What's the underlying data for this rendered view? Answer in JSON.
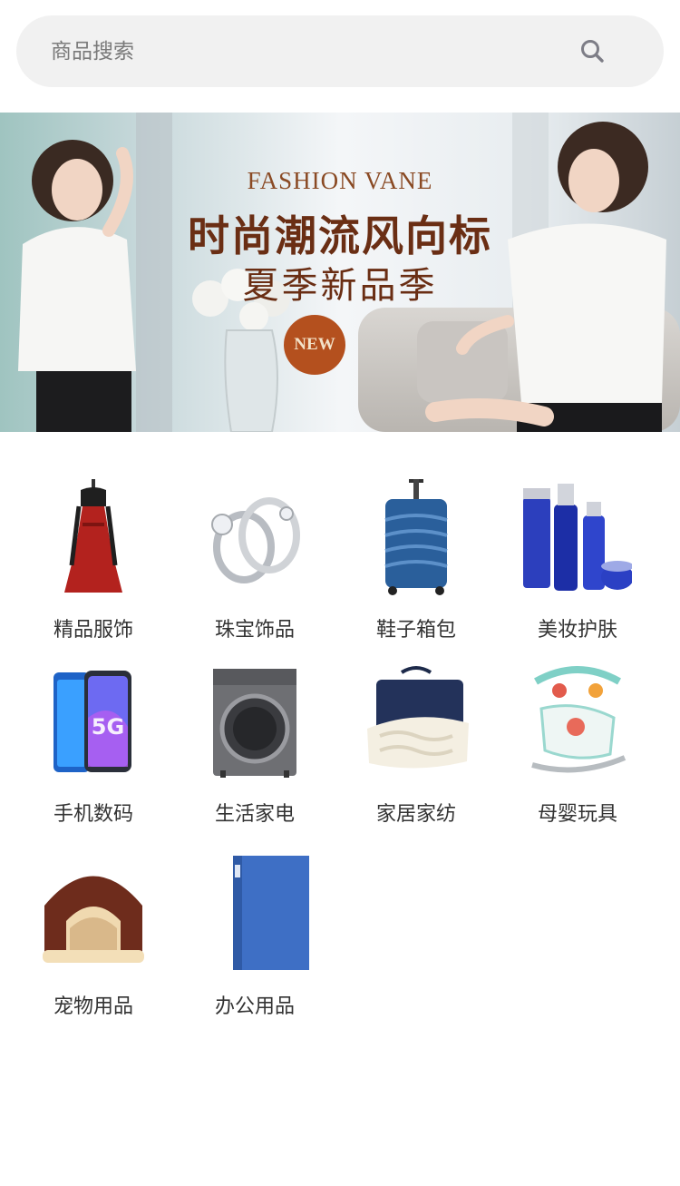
{
  "search": {
    "placeholder": "商品搜索"
  },
  "banner": {
    "subtitle_en": "FASHION VANE",
    "title": "时尚潮流风向标",
    "subtitle": "夏季新品季",
    "badge": "NEW"
  },
  "categories": [
    {
      "label": "精品服饰",
      "icon": "dress-icon"
    },
    {
      "label": "珠宝饰品",
      "icon": "rings-icon"
    },
    {
      "label": "鞋子箱包",
      "icon": "suitcase-icon"
    },
    {
      "label": "美妆护肤",
      "icon": "cosmetics-icon"
    },
    {
      "label": "手机数码",
      "icon": "phone-icon"
    },
    {
      "label": "生活家电",
      "icon": "washing-machine-icon"
    },
    {
      "label": "家居家纺",
      "icon": "pillow-icon"
    },
    {
      "label": "母婴玩具",
      "icon": "baby-rocker-icon"
    },
    {
      "label": "宠物用品",
      "icon": "pet-house-icon"
    },
    {
      "label": "办公用品",
      "icon": "folder-icon"
    }
  ],
  "colors": {
    "search_bg": "#f1f1f1",
    "banner_title": "#6a2e14",
    "badge": "#b4501e"
  }
}
